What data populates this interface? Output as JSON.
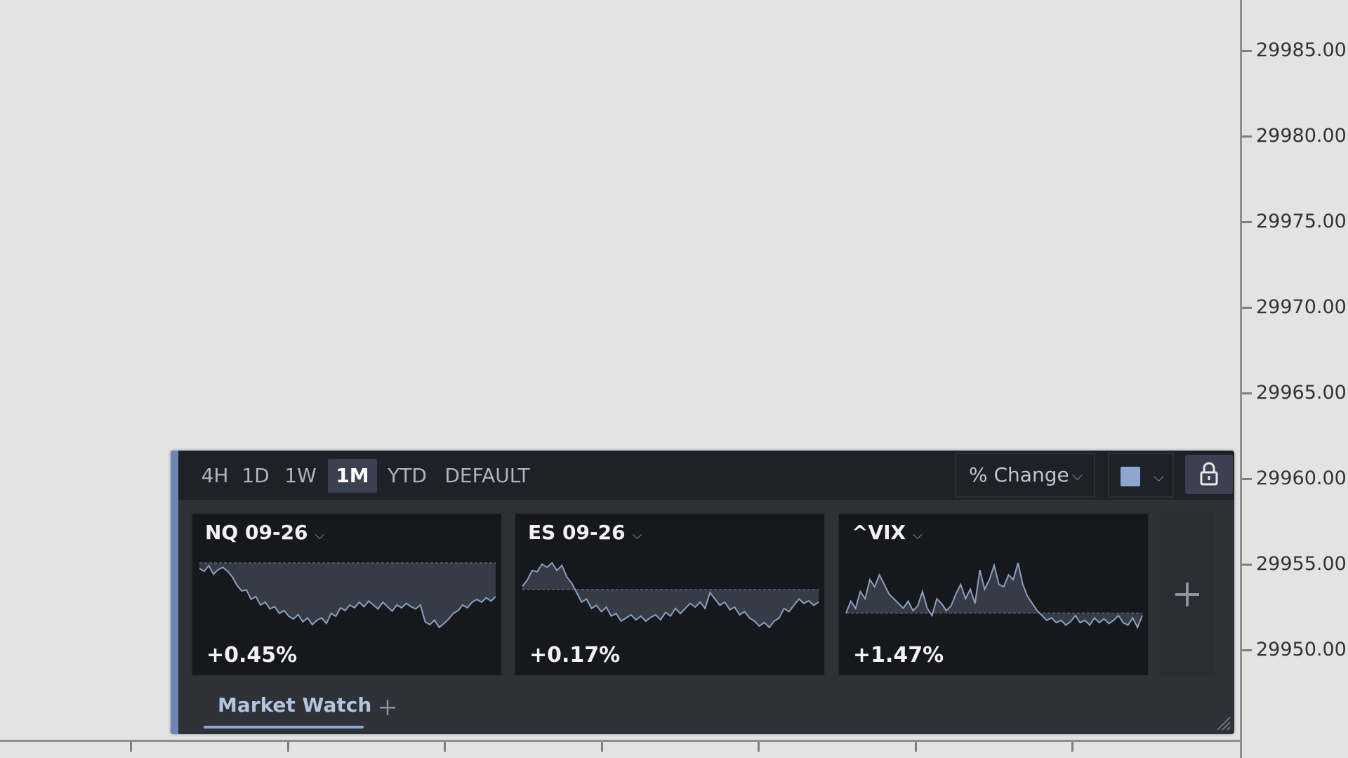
{
  "price_axis": {
    "labels": [
      "29985.00",
      "29980.00",
      "29975.00",
      "29970.00",
      "29965.00",
      "29960.00",
      "29955.00",
      "29950.00"
    ]
  },
  "widget": {
    "title": "Market Watch",
    "accent_color": "#6c87b2",
    "ranges": [
      {
        "label": "4H",
        "active": false
      },
      {
        "label": "1D",
        "active": false
      },
      {
        "label": "1W",
        "active": false
      },
      {
        "label": "1M",
        "active": true
      },
      {
        "label": "YTD",
        "active": false
      },
      {
        "label": "DEFAULT",
        "active": false
      }
    ],
    "metric_select": {
      "value": "% Change",
      "icon": "chevron-down-icon"
    },
    "color_select": {
      "swatch_color": "#8aa6d1",
      "icon": "chevron-down-icon"
    },
    "lock": {
      "icon": "lock-icon"
    },
    "cards": [
      {
        "symbol": "NQ 09-26",
        "change": "+0.45%",
        "baseline": 0.2,
        "series": [
          0.1,
          0.05,
          0.15,
          0.0,
          0.08,
          0.12,
          0.05,
          -0.05,
          -0.2,
          -0.3,
          -0.28,
          -0.45,
          -0.4,
          -0.55,
          -0.5,
          -0.62,
          -0.58,
          -0.7,
          -0.65,
          -0.75,
          -0.8,
          -0.72,
          -0.85,
          -0.78,
          -0.9,
          -0.82,
          -0.78,
          -0.88,
          -0.7,
          -0.75,
          -0.6,
          -0.65,
          -0.55,
          -0.6,
          -0.5,
          -0.58,
          -0.48,
          -0.55,
          -0.62,
          -0.5,
          -0.58,
          -0.66,
          -0.55,
          -0.6,
          -0.52,
          -0.58,
          -0.62,
          -0.55,
          -0.85,
          -0.9,
          -0.82,
          -0.95,
          -0.88,
          -0.8,
          -0.7,
          -0.65,
          -0.55,
          -0.6,
          -0.5,
          -0.45,
          -0.5,
          -0.42,
          -0.48,
          -0.4
        ]
      },
      {
        "symbol": "ES 09-26",
        "change": "+0.17%",
        "baseline": 0.0,
        "series": [
          0.05,
          0.15,
          0.3,
          0.28,
          0.4,
          0.35,
          0.42,
          0.3,
          0.38,
          0.2,
          0.1,
          -0.05,
          -0.2,
          -0.15,
          -0.3,
          -0.25,
          -0.35,
          -0.28,
          -0.42,
          -0.38,
          -0.5,
          -0.45,
          -0.4,
          -0.48,
          -0.42,
          -0.5,
          -0.44,
          -0.4,
          -0.48,
          -0.36,
          -0.42,
          -0.3,
          -0.38,
          -0.3,
          -0.22,
          -0.28,
          -0.2,
          -0.3,
          -0.05,
          -0.15,
          -0.25,
          -0.2,
          -0.32,
          -0.28,
          -0.4,
          -0.35,
          -0.45,
          -0.5,
          -0.58,
          -0.52,
          -0.6,
          -0.5,
          -0.45,
          -0.3,
          -0.35,
          -0.25,
          -0.15,
          -0.22,
          -0.18,
          -0.25,
          -0.2
        ]
      },
      {
        "symbol": "^VIX",
        "change": "+1.47%",
        "baseline": 0.0,
        "series": [
          0.0,
          0.25,
          0.1,
          0.45,
          0.3,
          0.7,
          0.55,
          0.8,
          0.6,
          0.4,
          0.3,
          0.2,
          0.1,
          0.25,
          0.05,
          0.15,
          0.45,
          0.1,
          -0.05,
          0.3,
          0.2,
          0.05,
          0.15,
          0.4,
          0.6,
          0.3,
          0.5,
          0.2,
          0.9,
          0.5,
          0.7,
          1.0,
          0.6,
          0.55,
          0.8,
          0.7,
          1.05,
          0.6,
          0.35,
          0.2,
          0.05,
          -0.05,
          -0.15,
          -0.1,
          -0.2,
          -0.15,
          -0.25,
          -0.18,
          -0.05,
          -0.2,
          -0.15,
          -0.25,
          -0.1,
          -0.2,
          -0.12,
          -0.22,
          -0.15,
          -0.05,
          -0.2,
          -0.25,
          -0.1,
          -0.3,
          -0.05
        ]
      }
    ],
    "add_card": {
      "icon": "plus-icon"
    },
    "tabs": [
      {
        "label": "Market Watch",
        "active": true
      }
    ],
    "add_tab": {
      "icon": "plus-icon"
    },
    "resize": {
      "icon": "resize-grip-icon"
    }
  }
}
